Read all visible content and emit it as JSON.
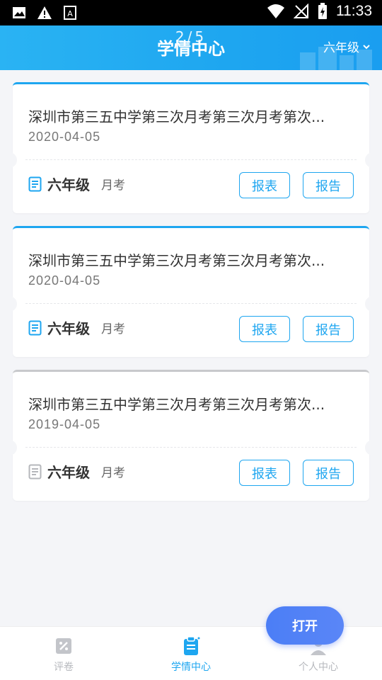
{
  "status_bar": {
    "time": "11:33"
  },
  "header": {
    "title": "学情中心",
    "page_indicator": "2/5",
    "grade_filter": "六年级"
  },
  "cards": [
    {
      "title": "深圳市第三五中学第三次月考第三次月考第次...",
      "date": "2020-04-05",
      "grade": "六年级",
      "type": "月考",
      "report_table": "报表",
      "report": "报告",
      "status": "active"
    },
    {
      "title": "深圳市第三五中学第三次月考第三次月考第次...",
      "date": "2020-04-05",
      "grade": "六年级",
      "type": "月考",
      "report_table": "报表",
      "report": "报告",
      "status": "active"
    },
    {
      "title": "深圳市第三五中学第三次月考第三次月考第次...",
      "date": "2019-04-05",
      "grade": "六年级",
      "type": "月考",
      "report_table": "报表",
      "report": "报告",
      "status": "inactive"
    }
  ],
  "open_button": "打开",
  "tabs": [
    {
      "label": "评卷",
      "icon": "grading-icon",
      "active": false
    },
    {
      "label": "学情中心",
      "icon": "clipboard-icon",
      "active": true
    },
    {
      "label": "个人中心",
      "icon": "user-icon",
      "active": false
    }
  ],
  "colors": {
    "accent": "#1ea6f0",
    "inactive_border": "#c8c9cc",
    "open_button": "#4b7ef6"
  }
}
